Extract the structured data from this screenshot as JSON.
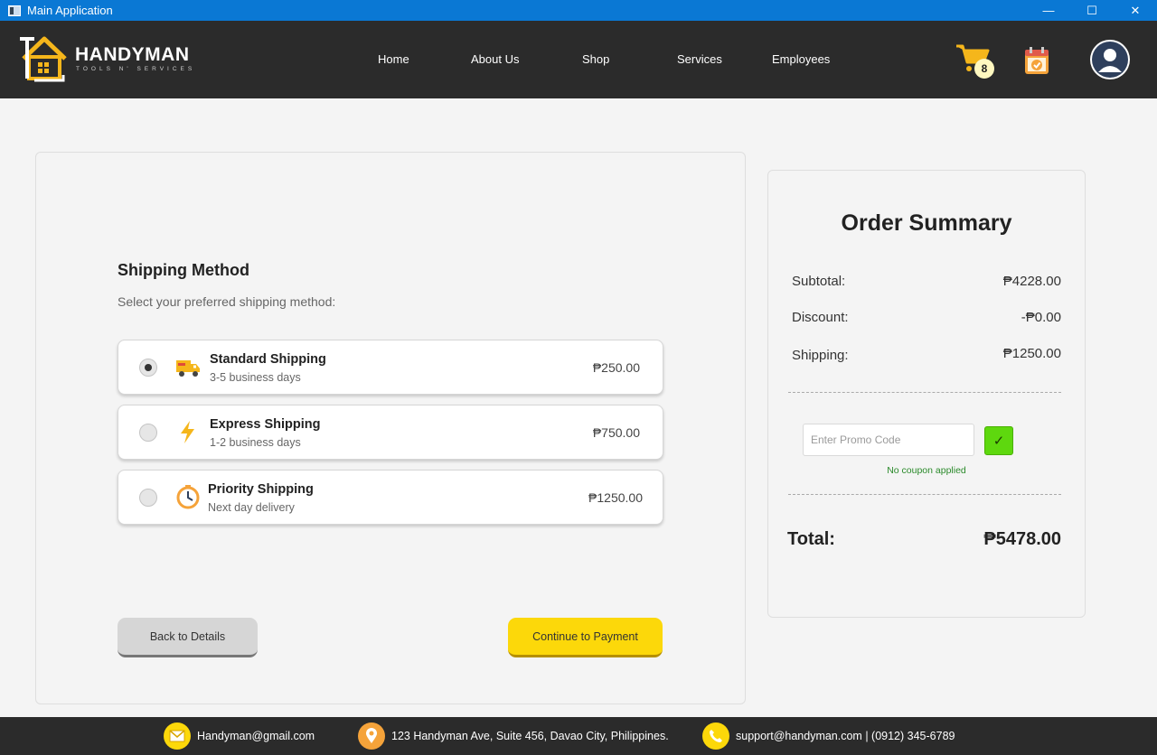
{
  "window": {
    "title": "Main Application",
    "controls": {
      "minimize": "—",
      "maximize": "☐",
      "close": "✕"
    }
  },
  "brand": {
    "name": "HANDYMAN",
    "tagline": "TOOLS N' SERVICES"
  },
  "nav": {
    "items": [
      "Home",
      "About Us",
      "Shop",
      "Services",
      "Employees"
    ],
    "cart_count": "8"
  },
  "shipping": {
    "title": "Shipping Method",
    "subtitle": "Select your preferred shipping method:",
    "options": [
      {
        "name": "Standard Shipping",
        "desc": "3-5 business days",
        "price": "₱250.00",
        "icon": "truck-icon",
        "selected": true
      },
      {
        "name": "Express Shipping",
        "desc": "1-2 business days",
        "price": "₱750.00",
        "icon": "lightning-icon",
        "selected": false
      },
      {
        "name": "Priority Shipping",
        "desc": "Next day delivery",
        "price": "₱1250.00",
        "icon": "clock-icon",
        "selected": false
      }
    ],
    "back_label": "Back to Details",
    "continue_label": "Continue to Payment"
  },
  "summary": {
    "title": "Order Summary",
    "subtotal_label": "Subtotal:",
    "subtotal_value": "₱4228.00",
    "discount_label": "Discount:",
    "discount_value": "-₱0.00",
    "shipping_label": "Shipping:",
    "shipping_value": "₱1250.00",
    "promo_placeholder": "Enter Promo Code",
    "apply_label": "✓",
    "coupon_status": "No coupon applied",
    "total_label": "Total:",
    "total_value": "₱5478.00"
  },
  "footer": {
    "email": "Handyman@gmail.com",
    "address": "123 Handyman Ave, Suite 456, Davao City, Philippines.",
    "support": "support@handyman.com | (0912) 345-6789"
  },
  "colors": {
    "accent_yellow": "#fcd80a",
    "nav_bg": "#2b2b2b",
    "titlebar_blue": "#0a78d4",
    "apply_green": "#5ed80e"
  }
}
